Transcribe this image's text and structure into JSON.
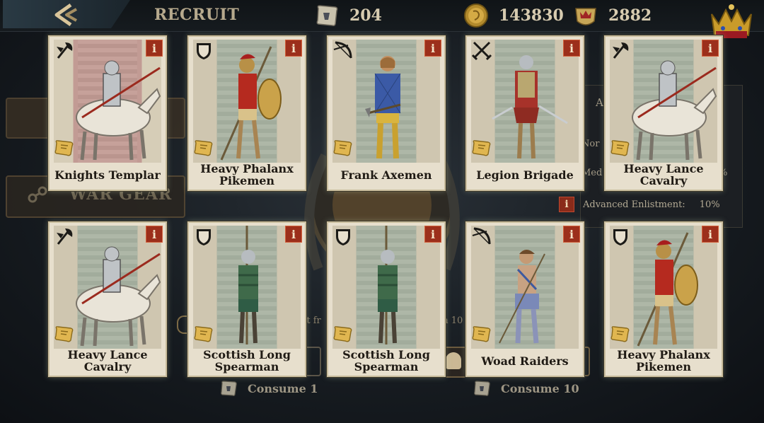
{
  "header": {
    "title": "RECRUIT",
    "resources": [
      {
        "name": "scroll",
        "icon": "scroll-icon",
        "value": "204"
      },
      {
        "name": "gold",
        "icon": "gold-coin-icon",
        "value": "143830"
      },
      {
        "name": "crown",
        "icon": "crown-badge-icon",
        "value": "2882"
      }
    ]
  },
  "background": {
    "war_gear_label": "WAR GEAR",
    "bonus_partial_a": "A",
    "bonus_row1": "Nor",
    "bonus_row2": "Med",
    "bonus_row2_suffix": "%",
    "advanced_enlistment_label": "Advanced Enlistment:",
    "advanced_enlistment_value": "10%",
    "partial_text_left": "nt fr",
    "partial_text_right": "th 10"
  },
  "consume": {
    "single": "Consume 1",
    "ten": "Consume 10"
  },
  "units": [
    {
      "name": "Knights Templar",
      "type": "axe-banner-icon",
      "style": "red",
      "fig": "cavalry"
    },
    {
      "name": "Heavy Phalanx Pikemen",
      "type": "shield-icon",
      "style": "green",
      "fig": "pike"
    },
    {
      "name": "Frank Axemen",
      "type": "bow-icon",
      "style": "green",
      "fig": "axe"
    },
    {
      "name": "Legion Brigade",
      "type": "crossed-swords-icon",
      "style": "green",
      "fig": "sword"
    },
    {
      "name": "Heavy Lance Cavalry",
      "type": "axe-banner-icon",
      "style": "green",
      "fig": "cavalry"
    },
    {
      "name": "Heavy Lance Cavalry",
      "type": "axe-banner-icon",
      "style": "green",
      "fig": "cavalry"
    },
    {
      "name": "Scottish Long Spearman",
      "type": "shield-icon",
      "style": "green",
      "fig": "spear"
    },
    {
      "name": "Scottish Long Spearman",
      "type": "shield-icon",
      "style": "green",
      "fig": "spear"
    },
    {
      "name": "Woad Raiders",
      "type": "bow-icon",
      "style": "green",
      "fig": "raider"
    },
    {
      "name": "Heavy Phalanx Pikemen",
      "type": "shield-icon",
      "style": "green",
      "fig": "pike"
    }
  ],
  "colors": {
    "info_red": "#9c2f1b",
    "card_bg": "#e7dfcd",
    "header_text": "#d7cbb0"
  }
}
